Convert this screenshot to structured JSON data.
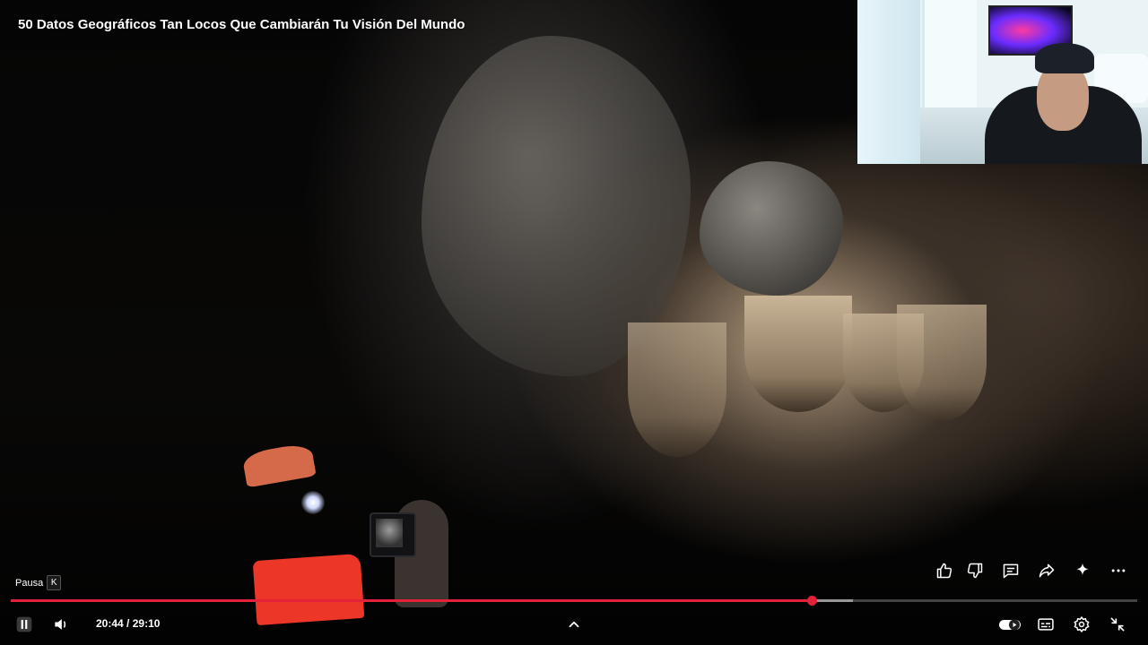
{
  "video": {
    "title": "50 Datos Geográficos Tan Locos Que Cambiarán Tu Visión Del Mundo",
    "current_time": "20:44",
    "duration": "29:10",
    "progress_fraction": 0.711,
    "buffered_fraction": 0.748
  },
  "tooltip": {
    "label": "Pausa",
    "shortcut": "K"
  },
  "actions": {
    "icons": [
      "like-icon",
      "dislike-icon",
      "comment-icon",
      "share-icon",
      "sparkle-icon",
      "more-icon"
    ]
  },
  "controls": {
    "icons": [
      "pause-icon",
      "volume-icon",
      "chevron-up-icon",
      "autoplay-toggle-icon",
      "captions-icon",
      "settings-icon",
      "exit-fullscreen-icon"
    ]
  },
  "colors": {
    "accent": "#e3223a",
    "text": "#ffffff"
  }
}
